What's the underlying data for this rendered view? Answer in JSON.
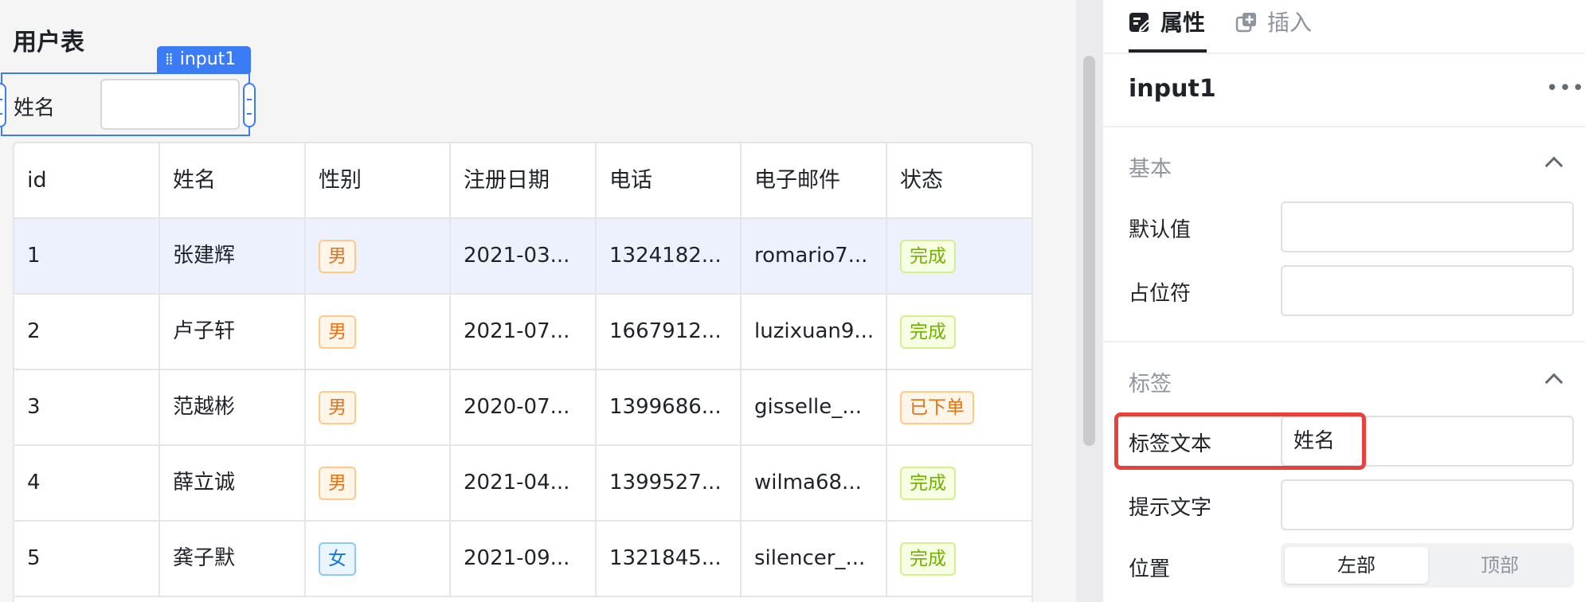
{
  "page": {
    "title": "用户表"
  },
  "input_widget": {
    "tag_label": "input1",
    "label": "姓名",
    "value": ""
  },
  "table": {
    "columns": [
      "id",
      "姓名",
      "性别",
      "注册日期",
      "电话",
      "电子邮件",
      "状态"
    ],
    "rows": [
      {
        "id": "1",
        "name": "张建辉",
        "gender": "男",
        "date": "2021-03...",
        "phone": "1324182...",
        "email": "romario7...",
        "status": "完成"
      },
      {
        "id": "2",
        "name": "卢子轩",
        "gender": "男",
        "date": "2021-07...",
        "phone": "1667912...",
        "email": "luzixuan9...",
        "status": "完成"
      },
      {
        "id": "3",
        "name": "范越彬",
        "gender": "男",
        "date": "2020-07...",
        "phone": "1399686...",
        "email": "gisselle_...",
        "status": "已下单"
      },
      {
        "id": "4",
        "name": "薛立诚",
        "gender": "男",
        "date": "2021-04...",
        "phone": "1399527...",
        "email": "wilma68...",
        "status": "完成"
      },
      {
        "id": "5",
        "name": "龚子默",
        "gender": "女",
        "date": "2021-09...",
        "phone": "1321845...",
        "email": "silencer_...",
        "status": "完成"
      }
    ]
  },
  "panel": {
    "tabs": {
      "properties": "属性",
      "insert": "插入"
    },
    "component_name": "input1",
    "more": "•••",
    "sections": {
      "basic": {
        "title": "基本",
        "default_value": "默认值",
        "placeholder": "占位符"
      },
      "label": {
        "title": "标签",
        "label_text": "标签文本",
        "label_text_value": "姓名",
        "hint_text": "提示文字",
        "position": "位置",
        "pos_left": "左部",
        "pos_top": "顶部"
      }
    }
  },
  "icons": {
    "properties_tab": "edit-square-icon",
    "insert_tab": "add-copy-icon"
  },
  "colors": {
    "accent": "#3b7bf6",
    "highlight": "#e8413c",
    "male_tag": "#e37318",
    "female_tag": "#1677d9",
    "done_tag": "#73b000"
  }
}
